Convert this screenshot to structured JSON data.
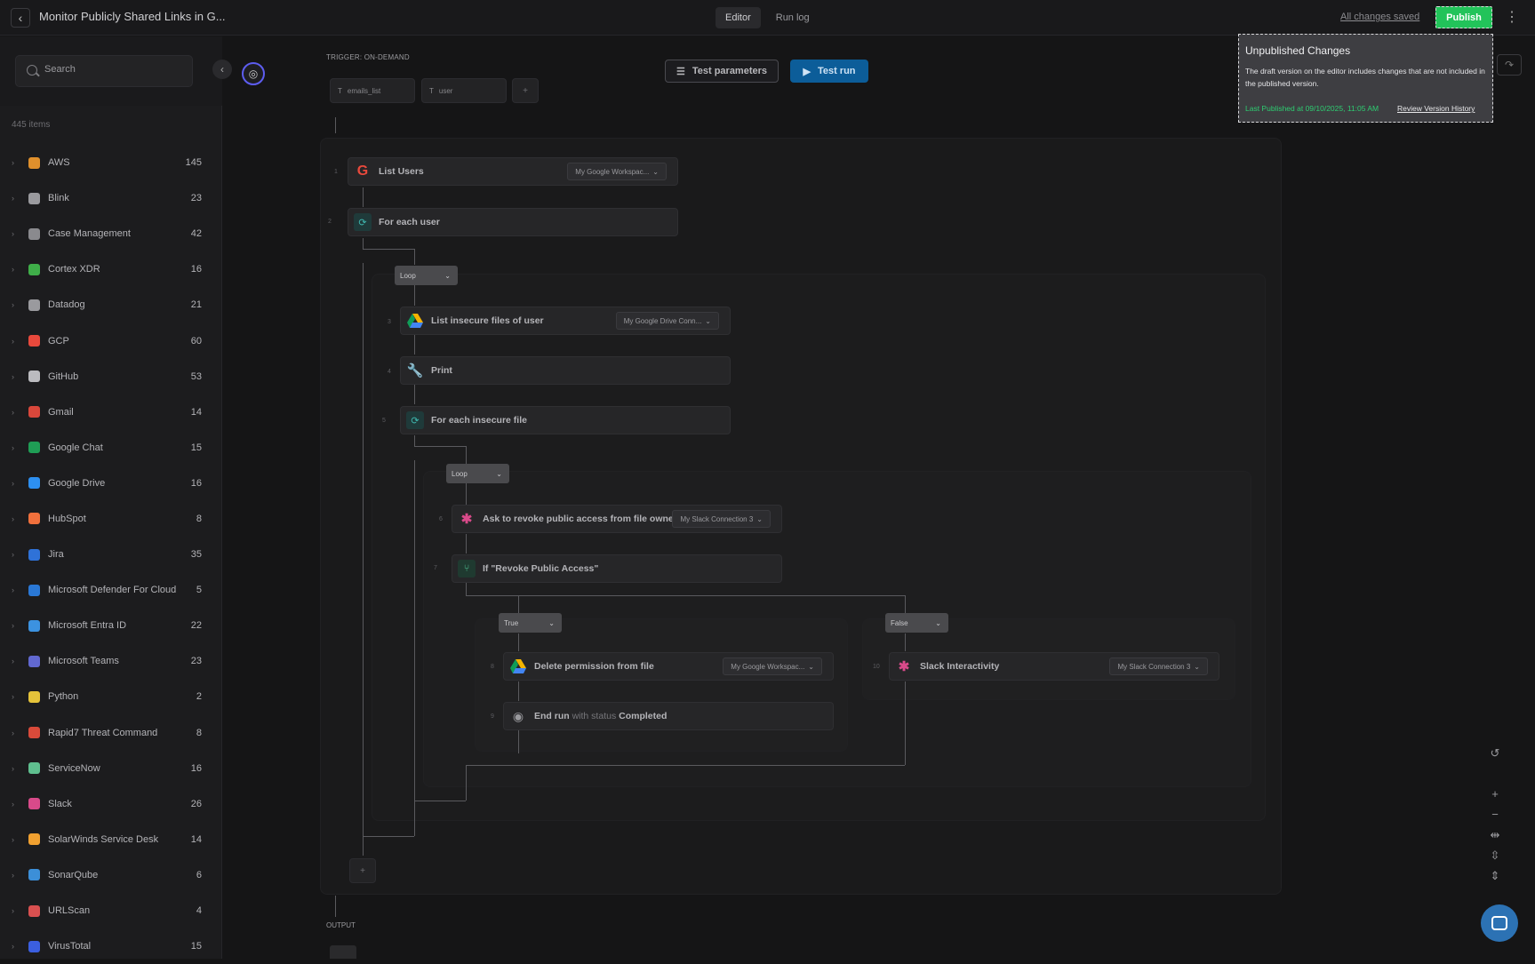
{
  "header": {
    "title": "Monitor Publicly Shared Links in G...",
    "tabs": [
      {
        "label": "Editor",
        "active": true
      },
      {
        "label": "Run log",
        "active": false
      }
    ],
    "status": "All changes saved",
    "publish_label": "Publish",
    "publish_color": "#22c35a"
  },
  "sidebar": {
    "search_placeholder": "Search",
    "items_count": "445 items",
    "items": [
      {
        "label": "AWS",
        "count": "145",
        "color": "#e0902c"
      },
      {
        "label": "Blink",
        "count": "23",
        "color": "#9a9a9e"
      },
      {
        "label": "Case Management",
        "count": "42",
        "color": "#8a8a8e"
      },
      {
        "label": "Cortex XDR",
        "count": "16",
        "color": "#3fae49"
      },
      {
        "label": "Datadog",
        "count": "21",
        "color": "#9a9a9e"
      },
      {
        "label": "GCP",
        "count": "60",
        "color": "#e8493c"
      },
      {
        "label": "GitHub",
        "count": "53",
        "color": "#bbbbbf"
      },
      {
        "label": "Gmail",
        "count": "14",
        "color": "#d9473b"
      },
      {
        "label": "Google Chat",
        "count": "15",
        "color": "#1f9d55"
      },
      {
        "label": "Google Drive",
        "count": "16",
        "color": "#2d8ff0"
      },
      {
        "label": "HubSpot",
        "count": "8",
        "color": "#f0703c"
      },
      {
        "label": "Jira",
        "count": "35",
        "color": "#2f72d8"
      },
      {
        "label": "Microsoft Defender For Cloud",
        "count": "5",
        "color": "#2a78d6"
      },
      {
        "label": "Microsoft Entra ID",
        "count": "22",
        "color": "#3c92e0"
      },
      {
        "label": "Microsoft Teams",
        "count": "23",
        "color": "#6168d0"
      },
      {
        "label": "Python",
        "count": "2",
        "color": "#e5c33a"
      },
      {
        "label": "Rapid7 Threat Command",
        "count": "8",
        "color": "#d94a3a"
      },
      {
        "label": "ServiceNow",
        "count": "16",
        "color": "#5fbf8f"
      },
      {
        "label": "Slack",
        "count": "26",
        "color": "#d94a8a"
      },
      {
        "label": "SolarWinds Service Desk",
        "count": "14",
        "color": "#f0a030"
      },
      {
        "label": "SonarQube",
        "count": "6",
        "color": "#3c8fd8"
      },
      {
        "label": "URLScan",
        "count": "4",
        "color": "#d95050"
      },
      {
        "label": "VirusTotal",
        "count": "15",
        "color": "#3b5fe0"
      }
    ]
  },
  "canvas": {
    "trigger_label": "TRIGGER: ON-DEMAND",
    "params": [
      "emails_list",
      "user"
    ],
    "add_param": "+",
    "test_params_label": "Test parameters",
    "test_run_label": "Test run",
    "output_label": "OUTPUT",
    "add_step": "+",
    "steps": [
      {
        "num": "1",
        "label": "List Users",
        "connection": "My Google Workspac..."
      },
      {
        "num": "2",
        "label": "For each user"
      },
      {
        "num": "3",
        "label": "List insecure files of user",
        "connection": "My Google Drive Conn..."
      },
      {
        "num": "4",
        "label": "Print"
      },
      {
        "num": "5",
        "label": "For each insecure file"
      },
      {
        "num": "6",
        "label": "Ask to revoke public access from file owner",
        "connection": "My Slack Connection 3"
      },
      {
        "num": "7",
        "label": "If \"Revoke Public Access\""
      },
      {
        "num": "8",
        "label": "Delete permission from file",
        "connection": "My Google Workspac..."
      },
      {
        "num": "9",
        "label": "End run",
        "sub": "with status",
        "status": "Completed"
      },
      {
        "num": "10",
        "label": "Slack Interactivity",
        "connection": "My Slack Connection 3"
      }
    ],
    "pills": {
      "loop1": "Loop",
      "loop2": "Loop",
      "true": "True",
      "false": "False"
    }
  },
  "tooltip": {
    "title": "Unpublished Changes",
    "body": "The draft version on the editor includes changes that are not included in the published version.",
    "last_published": "Last Published at 09/10/2025, 11:05 AM",
    "review_link": "Review Version History"
  }
}
